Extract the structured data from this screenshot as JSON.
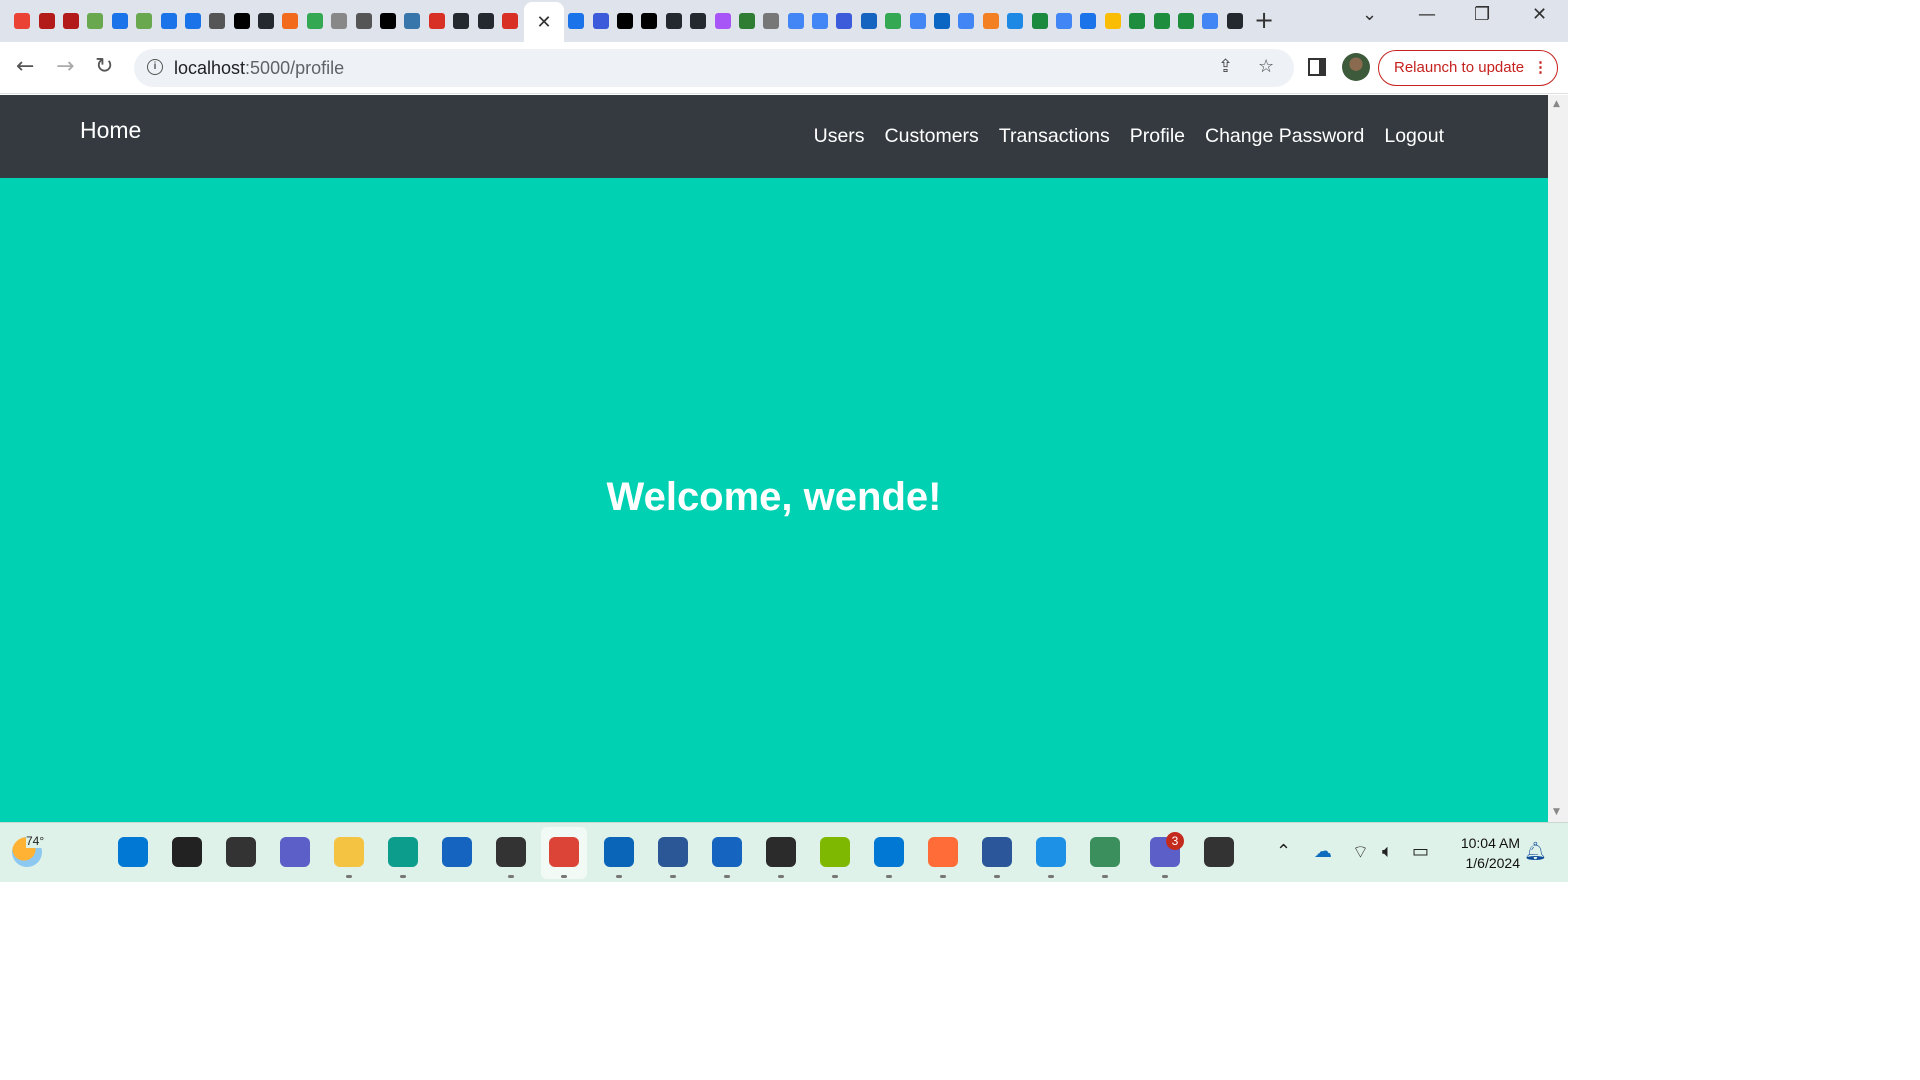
{
  "browser": {
    "url_host": "localhost",
    "url_path": ":5000/profile",
    "relaunch_label": "Relaunch to update",
    "tab_close_glyph": "✕",
    "new_tab_glyph": "+"
  },
  "page": {
    "brand": "Home",
    "nav_links": [
      "Users",
      "Customers",
      "Transactions",
      "Profile",
      "Change Password",
      "Logout"
    ],
    "welcome": "Welcome, wende!"
  },
  "taskbar": {
    "temperature": "74°",
    "time": "10:04 AM",
    "date": "1/6/2024",
    "notification_count": "3"
  },
  "colors": {
    "navbar_bg": "#343a40",
    "page_bg": "#00d1b2",
    "accent_red": "#c5221f"
  }
}
